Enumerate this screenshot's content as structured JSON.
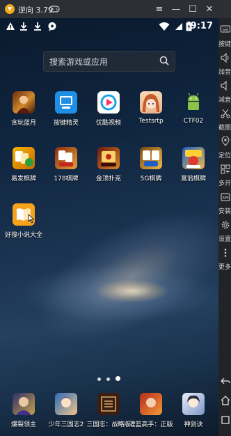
{
  "window": {
    "title": "逆向 3.79",
    "buttons": [
      "≡",
      "—",
      "☐",
      "✕"
    ]
  },
  "statusbar": {
    "time": "9:17"
  },
  "search": {
    "placeholder": "搜索游戏或应用"
  },
  "apps_row1": [
    {
      "label": "贪玩蓝月",
      "icon": "game-avatar-icon"
    },
    {
      "label": "按键精灵",
      "icon": "keyboard-sprite-icon"
    },
    {
      "label": "优酷视频",
      "icon": "youku-play-icon"
    },
    {
      "label": "Testsrtp",
      "icon": "anime-girl-icon"
    },
    {
      "label": "CTF02",
      "icon": "android-robot-icon"
    }
  ],
  "apps_row2": [
    {
      "label": "易发棋牌",
      "icon": "chess-cards-icon"
    },
    {
      "label": "178棋牌",
      "icon": "chess-cards-icon"
    },
    {
      "label": "金顶扑克",
      "icon": "poker-icon"
    },
    {
      "label": "5G棋牌",
      "icon": "chess-cards-icon"
    },
    {
      "label": "富翁棋牌",
      "icon": "chess-cards-icon"
    }
  ],
  "apps_row3": [
    {
      "label": "好搜小说大全",
      "icon": "book-icon"
    }
  ],
  "dock": [
    {
      "label": "爆裂领主"
    },
    {
      "label": "少年三国志2"
    },
    {
      "label": "三国志：战略版"
    },
    {
      "label": "灌篮高手：正版"
    },
    {
      "label": "神剑诀"
    }
  ],
  "toolbar": {
    "keyboard": "按键",
    "vol_up": "加音",
    "vol_down": "减音",
    "screenshot": "截图",
    "location": "定位",
    "multi": "多开",
    "install": "安装",
    "settings": "设置",
    "more": "更多"
  },
  "colors": {
    "titlebar": "#2c2f36",
    "toolbar": "#212327",
    "accent": "#1aa1e8"
  }
}
